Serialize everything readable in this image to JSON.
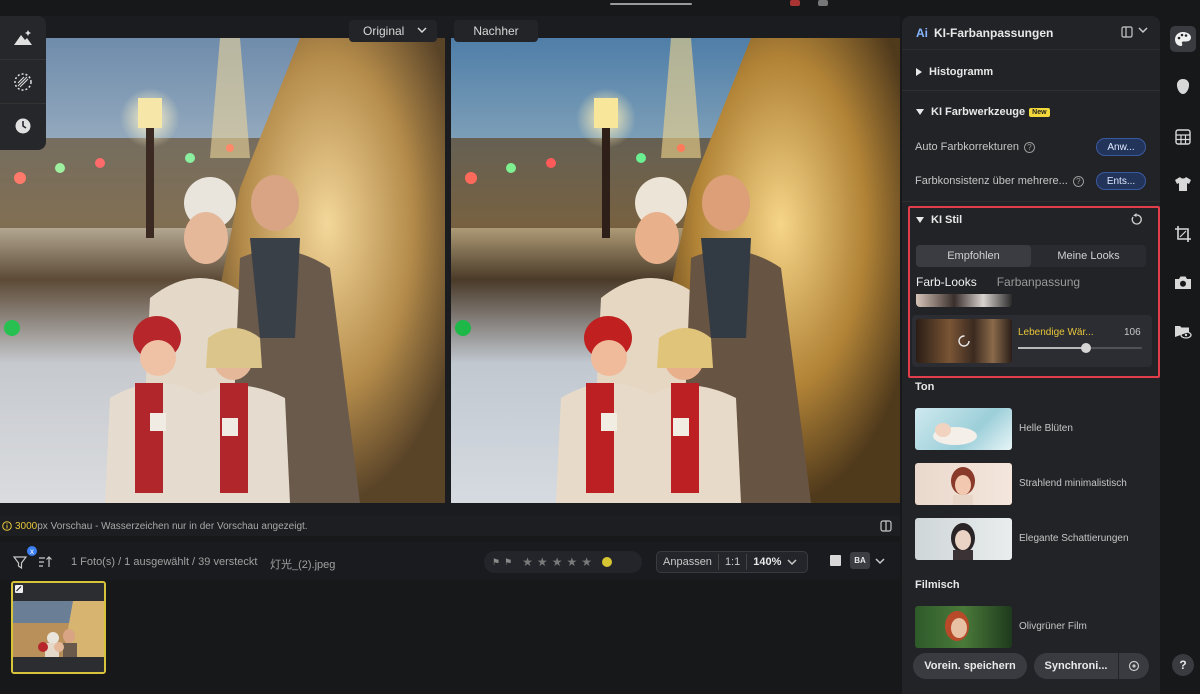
{
  "comparison": {
    "before_label": "Original",
    "after_label": "Nachher"
  },
  "statusbar": {
    "resolution": "3000",
    "message": "px Vorschau - Wasserzeichen nur in der Vorschau angezeigt."
  },
  "filmbar": {
    "info": "1 Foto(s) / 1 ausgewählt / 39 versteckt",
    "filename": "灯光_(2).jpeg",
    "badge": "x",
    "fit_label": "Anpassen",
    "one_to_one": "1:1",
    "zoom": "140%",
    "ba_label": "BA"
  },
  "panel": {
    "ai_badge": "Ai",
    "title": "KI-Farbanpassungen",
    "histogram": "Histogramm",
    "color_tools": "KI Farbwerkzeuge",
    "new_badge": "New",
    "auto_label": "Auto Farbkorrekturen",
    "auto_btn": "Anw...",
    "consistency_label": "Farbkonsistenz über mehrere...",
    "consistency_btn": "Ents...",
    "style_section": "KI Stil",
    "seg_recommended": "Empfohlen",
    "seg_my_looks": "Meine Looks",
    "tab_looks": "Farb-Looks",
    "tab_matching": "Farbanpassung",
    "active_look_name": "Lebendige Wär...",
    "active_look_value": "106",
    "active_look_level": 0.55,
    "group_tone": "Ton",
    "presets_tone": [
      {
        "name": "Helle Blüten"
      },
      {
        "name": "Strahlend minimalistisch"
      },
      {
        "name": "Elegante Schattierungen"
      }
    ],
    "group_film": "Filmisch",
    "presets_film": [
      {
        "name": "Olivgrüner Film"
      }
    ],
    "save_preset": "Vorein. speichern",
    "sync": "Synchroni..."
  },
  "rail": {
    "help": "?"
  },
  "colors": {
    "accent_yellow": "#e7c63b",
    "highlight_red": "#e23d4a",
    "button_blue": "#3a5aa0"
  }
}
